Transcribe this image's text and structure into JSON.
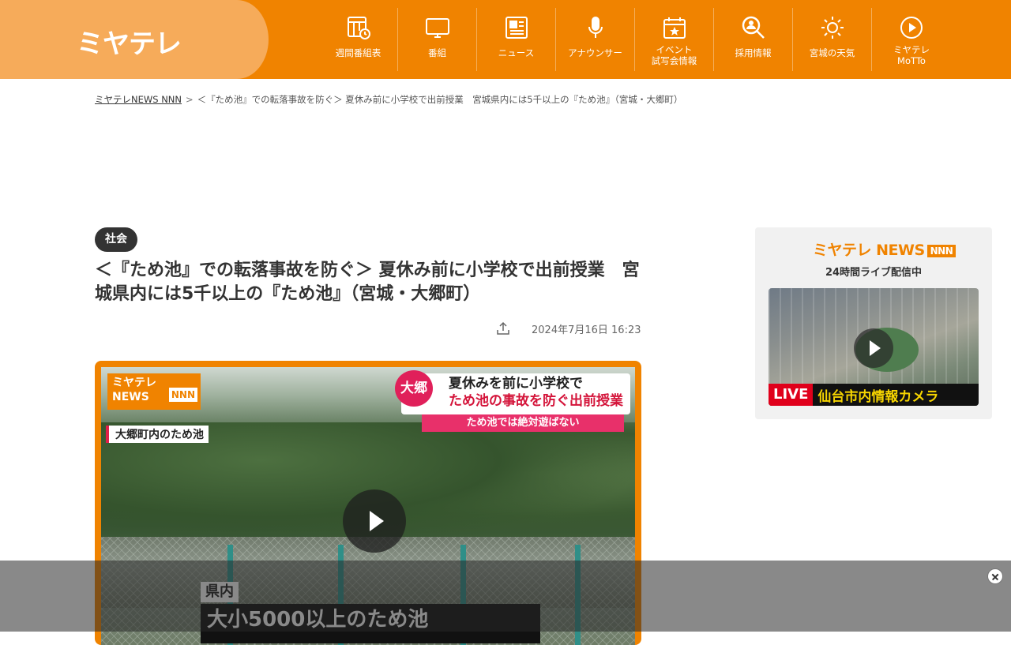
{
  "header": {
    "logo": "ミヤテレ",
    "nav": [
      {
        "label": "週間番組表",
        "icon": "schedule-icon"
      },
      {
        "label": "番組",
        "icon": "tv-icon"
      },
      {
        "label": "ニュース",
        "icon": "news-icon"
      },
      {
        "label": "アナウンサー",
        "icon": "microphone-icon"
      },
      {
        "label": "イベント\n試写会情報",
        "icon": "calendar-icon"
      },
      {
        "label": "採用情報",
        "icon": "search-person-icon"
      },
      {
        "label": "宮城の天気",
        "icon": "sun-icon"
      },
      {
        "label": "ミヤテレ\nMoTTo",
        "icon": "play-circle-icon"
      }
    ]
  },
  "breadcrumb": {
    "home": "ミヤテレNEWS NNN",
    "separator": ">",
    "current": "＜『ため池』での転落事故を防ぐ＞ 夏休み前に小学校で出前授業　宮城県内には5千以上の『ため池』（宮城・大郷町）"
  },
  "article": {
    "category": "社会",
    "title": "＜『ため池』での転落事故を防ぐ＞ 夏休み前に小学校で出前授業　宮城県内には5千以上の『ため池』（宮城・大郷町）",
    "date": "2024年7月16日 16:23"
  },
  "video": {
    "logo_line1": "ミヤテレ",
    "logo_line2": "NEWS",
    "logo_nnn": "NNN",
    "location": "大郷町内のため池",
    "badge": "大郷",
    "headline1": "夏休みを前に小学校で",
    "headline2": "ため池の事故を防ぐ出前授業",
    "subheadline": "ため池では絶対遊ばない",
    "tag": "県内",
    "caption": "大小5000以上のため池"
  },
  "sidebar": {
    "logo": "ミヤテレ NEWS",
    "logo_nnn": "NNN",
    "subtitle": "24時間ライブ配信中",
    "live": "LIVE",
    "camera_title": "仙台市内情報カメラ"
  },
  "colors": {
    "brand_orange": "#f08300",
    "logo_bg": "#f6ab5a",
    "live_red": "#e0001b",
    "accent_pink": "#e0205a"
  }
}
